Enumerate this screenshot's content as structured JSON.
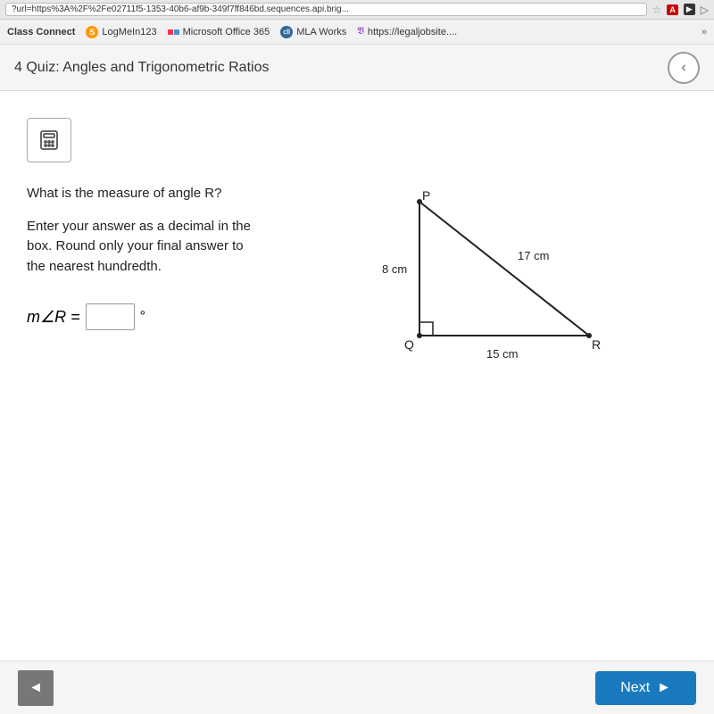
{
  "browser": {
    "url": "?url=https%3A%2F%2Fe02711f5-1353-40b6-af9b-349f7ff846bd.sequences.api.brig...",
    "star_icon": "☆",
    "pdf_icon": "A",
    "rec_icon": "▶",
    "arr_icon": "▷"
  },
  "bookmarks": [
    {
      "id": "classconnect",
      "label": "Class Connect",
      "icon_type": "text",
      "icon_bg": ""
    },
    {
      "id": "logmein",
      "label": "LogMeIn123",
      "icon_type": "circle",
      "icon_bg": "#f90"
    },
    {
      "id": "msoffice",
      "label": "Microsoft Office 365",
      "icon_type": "ms"
    },
    {
      "id": "mlaworks",
      "label": "MLA Works",
      "icon_type": "circle",
      "icon_bg": "#336699"
    },
    {
      "id": "legaljob",
      "label": "https://legaljobsite....",
      "icon_type": "text"
    }
  ],
  "header": {
    "title": "4 Quiz: Angles and Trigonometric Ratios",
    "back_btn_label": "‹"
  },
  "calc_icon": "▦",
  "question": {
    "line1": "What is the measure of angle R?",
    "line2": "Enter your answer as a decimal in the",
    "line3": "box. Round only your final answer to",
    "line4": "the nearest hundredth."
  },
  "answer": {
    "prefix": "m∠R =",
    "input_value": "",
    "input_placeholder": "",
    "suffix": "°"
  },
  "triangle": {
    "labels": {
      "P": "P",
      "Q": "Q",
      "R": "R",
      "side_PQ": "8 cm",
      "side_QR": "15 cm",
      "side_PR": "17 cm"
    }
  },
  "buttons": {
    "prev_label": "◄",
    "next_label": "Next",
    "next_arrow": "►"
  }
}
